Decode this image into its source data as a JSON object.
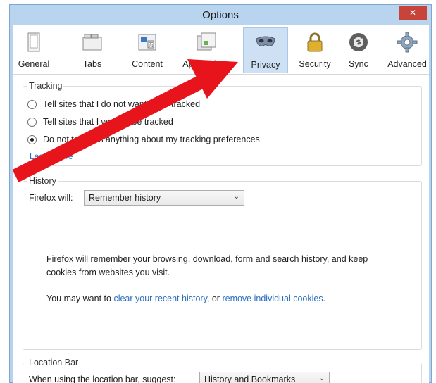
{
  "window": {
    "title": "Options",
    "close_label": "✕"
  },
  "toolbar": {
    "tabs": [
      {
        "label": "General",
        "icon": "general-icon"
      },
      {
        "label": "Tabs",
        "icon": "tabs-icon"
      },
      {
        "label": "Content",
        "icon": "content-icon"
      },
      {
        "label": "Applications",
        "icon": "applications-icon"
      },
      {
        "label": "Privacy",
        "icon": "privacy-mask-icon",
        "selected": true
      },
      {
        "label": "Security",
        "icon": "padlock-icon"
      },
      {
        "label": "Sync",
        "icon": "sync-icon"
      },
      {
        "label": "Advanced",
        "icon": "gear-icon"
      }
    ]
  },
  "tracking": {
    "legend": "Tracking",
    "options": [
      {
        "label": "Tell sites that I do not want to be tracked",
        "checked": false
      },
      {
        "label": "Tell sites that I want to be tracked",
        "checked": false
      },
      {
        "label": "Do not tell sites anything about my tracking preferences",
        "checked": true
      }
    ],
    "learn_more": "Learn More"
  },
  "history": {
    "legend": "History",
    "firefox_will_label": "Firefox will:",
    "selected_option": "Remember history",
    "description": "Firefox will remember your browsing, download, form and search history, and keep cookies from websites you visit.",
    "may_want_prefix": "You may want to ",
    "clear_link": "clear your recent history",
    "or_text": ", or ",
    "remove_link": "remove individual cookies",
    "period": "."
  },
  "location_bar": {
    "legend": "Location Bar",
    "suggest_label": "When using the location bar, suggest:",
    "selected_option": "History and Bookmarks"
  },
  "colors": {
    "annotation_arrow": "#e8141c",
    "link": "#2a6fc0",
    "close_button": "#c7443b",
    "selected_tab": "#cde0f4"
  }
}
